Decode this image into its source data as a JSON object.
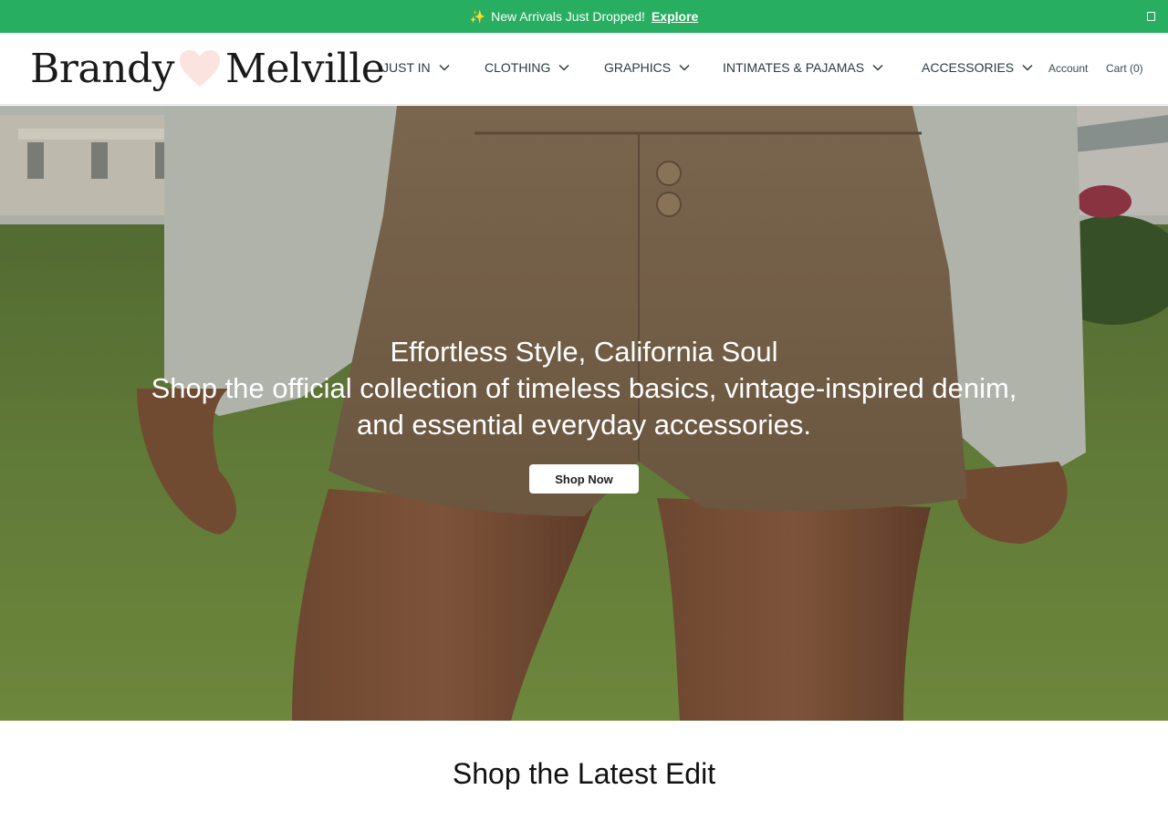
{
  "announcement": {
    "icon": "sparkles-icon",
    "text": "New Arrivals Just Dropped!",
    "link": "Explore",
    "background": "#27ae60"
  },
  "header": {
    "logo": {
      "left": "Brandy",
      "right": "Melville",
      "heart_color": "#fbe3df"
    },
    "nav": [
      {
        "label": "JUST IN"
      },
      {
        "label": "CLOTHING"
      },
      {
        "label": "GRAPHICS"
      },
      {
        "label": "INTIMATES & PAJAMAS"
      },
      {
        "label": "ACCESSORIES"
      }
    ],
    "account": "Account",
    "cart": "Cart (0)"
  },
  "hero": {
    "title": "Effortless Style, California Soul",
    "subtitle": "Shop the official collection of timeless basics, vintage-inspired denim, and essential everyday accessories.",
    "button": "Shop Now"
  },
  "section": {
    "title": "Shop the Latest Edit"
  }
}
